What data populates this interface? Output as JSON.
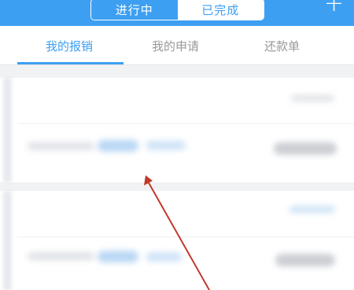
{
  "header": {
    "segments": [
      {
        "label": "进行中",
        "active": false
      },
      {
        "label": "已完成",
        "active": true
      }
    ],
    "add_icon": "plus-icon"
  },
  "tabs": [
    {
      "label": "我的报销",
      "active": true
    },
    {
      "label": "我的申请",
      "active": false
    },
    {
      "label": "还款单",
      "active": false
    }
  ],
  "colors": {
    "accent": "#3d9ff2",
    "annotation_arrow": "#c0392b"
  }
}
